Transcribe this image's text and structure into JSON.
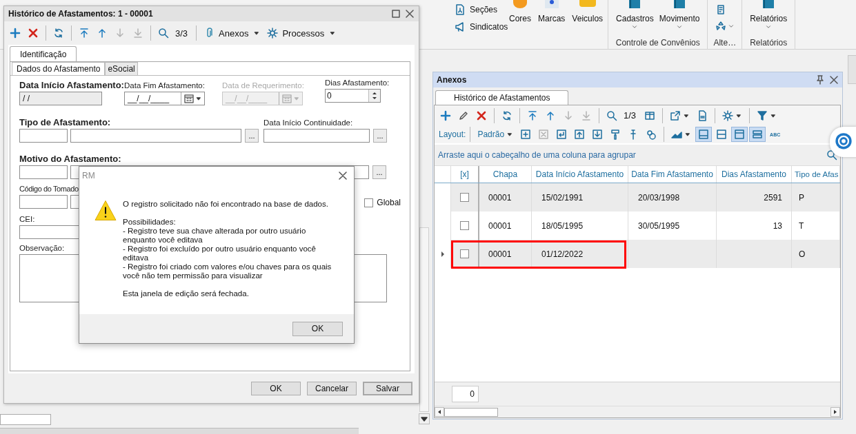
{
  "ribbon": {
    "small_items": [
      "Seções",
      "Sindicatos"
    ],
    "large_items": [
      "Cores",
      "Marcas",
      "Veiculos"
    ],
    "groups": [
      {
        "label": "Controle de Convênios",
        "buttons": [
          "Cadastros",
          "Movimento"
        ]
      },
      {
        "label": "Alte…"
      },
      {
        "label": "Relatórios",
        "buttons": [
          "Relatórios"
        ]
      }
    ]
  },
  "edit_window": {
    "title": "Histórico de Afastamentos: 1 - 00001",
    "toolbar": [
      [
        {
          "kind": "add",
          "disabled": false
        },
        {
          "kind": "delete",
          "disabled": false
        }
      ],
      [
        {
          "kind": "refresh",
          "disabled": false
        }
      ],
      [
        {
          "kind": "first",
          "disabled": false
        },
        {
          "kind": "prev",
          "disabled": false
        },
        {
          "kind": "next",
          "disabled": true
        },
        {
          "kind": "last",
          "disabled": true
        }
      ],
      [
        {
          "kind": "search",
          "disabled": false
        },
        {
          "kind": "counter",
          "label": "3/3"
        }
      ],
      [
        {
          "kind": "attach",
          "label": "Anexos",
          "caret": true,
          "disabled": false
        },
        {
          "kind": "gear",
          "label": "Processos",
          "caret": true,
          "disabled": false
        }
      ]
    ],
    "tabs": [
      {
        "label": "Identificação",
        "selected": true
      }
    ],
    "subtabs": [
      {
        "label": "Dados do Afastamento",
        "selected": true
      },
      {
        "label": "eSocial",
        "selected": false
      }
    ],
    "form": {
      "date_start": {
        "label": "Data Início Afastamento:",
        "value": "/ /",
        "required": true
      },
      "date_end": {
        "label": "Data Fim Afastamento:",
        "value": "__/__/____",
        "required": false,
        "disabled": false
      },
      "request_date": {
        "label": "Data de Requerimento:",
        "value": "__/__/____",
        "required": false,
        "disabled": true
      },
      "days": {
        "label": "Dias Afastamento:",
        "value": "0",
        "required": false,
        "disabled": false
      },
      "type": {
        "label": "Tipo de Afastamento:",
        "required": true,
        "lookup": "..."
      },
      "continuity": {
        "label": "Data Início Continuidade:",
        "required": false,
        "lookup": "..."
      },
      "reason": {
        "label": "Motivo do Afastamento:",
        "required": true,
        "lookup": "..."
      },
      "taker_code": {
        "label": "Código do Tomado",
        "required": false
      },
      "global": {
        "label": "Global",
        "checked": false
      },
      "cei": {
        "label": "CEI:",
        "required": false
      },
      "notes": {
        "label": "Observação:",
        "required": false
      }
    },
    "buttons": [
      "OK",
      "Cancelar",
      "Salvar"
    ]
  },
  "dialog": {
    "title": "RM",
    "paragraphs": [
      [
        "O registro solicitado não foi encontrado na base de dados."
      ],
      [
        "Possibilidades:",
        "- Registro teve sua chave alterada por outro usuário enquanto você editava",
        "- Registro foi excluído por outro usuário enquanto você editava",
        "- Registro foi criado com valores e/ou chaves para os quais você não tem permissão para visualizar"
      ],
      [
        "Esta janela de edição será fechada."
      ]
    ],
    "button": "OK"
  },
  "anexos": {
    "title": "Anexos",
    "tabs": [
      {
        "label": "Histórico de Afastamentos",
        "selected": true
      }
    ],
    "toolbar": [
      [
        {
          "kind": "add",
          "disabled": false
        },
        {
          "kind": "edit",
          "disabled": false
        },
        {
          "kind": "delete",
          "disabled": false
        }
      ],
      [
        {
          "kind": "refresh",
          "disabled": false
        }
      ],
      [
        {
          "kind": "first",
          "disabled": false
        },
        {
          "kind": "prev",
          "disabled": false
        },
        {
          "kind": "next",
          "disabled": true
        },
        {
          "kind": "last",
          "disabled": true
        }
      ],
      [
        {
          "kind": "search",
          "disabled": false
        },
        {
          "kind": "counter",
          "label": "1/3"
        },
        {
          "kind": "columns",
          "disabled": false
        }
      ],
      [
        {
          "kind": "export",
          "caret": true,
          "disabled": false
        },
        {
          "kind": "document",
          "disabled": false
        }
      ],
      [
        {
          "kind": "gear",
          "caret": true,
          "disabled": false
        }
      ],
      [
        {
          "kind": "filter",
          "caret": true,
          "disabled": false
        }
      ]
    ],
    "layout_label": "Layout:",
    "layout": "Padrão",
    "layout_tools": [
      [
        {
          "kind": "add-row",
          "disabled": false,
          "selected": false
        },
        {
          "kind": "delete-row",
          "disabled": true,
          "selected": false
        },
        {
          "kind": "wrap",
          "disabled": false,
          "selected": false
        },
        {
          "kind": "move-up",
          "disabled": false,
          "selected": false
        },
        {
          "kind": "move-down",
          "disabled": false,
          "selected": false
        },
        {
          "kind": "paint",
          "disabled": false,
          "selected": false
        },
        {
          "kind": "pin",
          "disabled": false,
          "selected": false
        },
        {
          "kind": "shapes",
          "disabled": false,
          "selected": false
        }
      ],
      [
        {
          "kind": "chart",
          "caret": true,
          "disabled": false,
          "selected": false
        },
        {
          "kind": "footer",
          "disabled": false,
          "selected": true
        },
        {
          "kind": "rows",
          "disabled": false,
          "selected": false
        },
        {
          "kind": "header",
          "disabled": false,
          "selected": true
        },
        {
          "kind": "bands",
          "disabled": false,
          "selected": true
        },
        {
          "kind": "text",
          "label": "ABC",
          "disabled": false,
          "selected": false
        }
      ]
    ],
    "group_hint": "Arraste aqui o cabeçalho de uma coluna para agrupar",
    "checkbox_column": "[x]",
    "columns": [
      "Chapa",
      "Data Início Afastamento",
      "Data Fim Afastamento",
      "Dias Afastamento",
      "Tipo de Afas"
    ],
    "rows": [
      {
        "checked": false,
        "current": false,
        "highlighted": false,
        "cells": [
          "00001",
          "15/02/1991",
          "20/03/1998",
          "2591",
          "P"
        ]
      },
      {
        "checked": false,
        "current": false,
        "highlighted": false,
        "cells": [
          "00001",
          "18/05/1995",
          "30/05/1995",
          "13",
          "T"
        ]
      },
      {
        "checked": false,
        "current": true,
        "highlighted": true,
        "cells": [
          "00001",
          "01/12/2022",
          null,
          null,
          "O"
        ]
      }
    ],
    "footer_total": "0"
  }
}
